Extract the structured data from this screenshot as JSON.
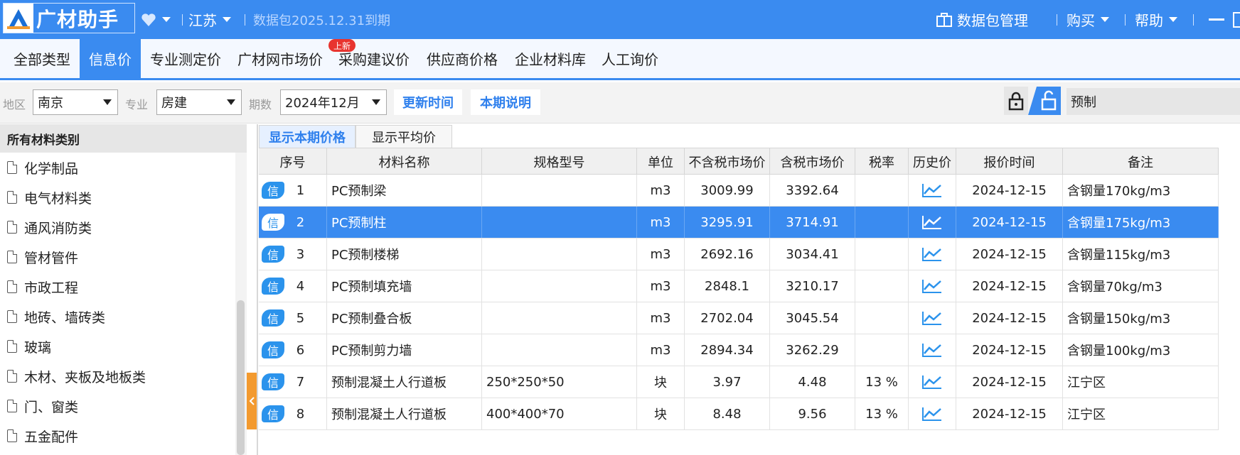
{
  "titlebar": {
    "logo_text": "广材助手",
    "region": "江苏",
    "package_expiry": "数据包2025.12.31到期",
    "package_manage": "数据包管理",
    "buy": "购买",
    "help": "帮助"
  },
  "nav": {
    "tabs": [
      "全部类型",
      "信息价",
      "专业测定价",
      "广材网市场价",
      "采购建议价",
      "供应商价格",
      "企业材料库",
      "人工询价"
    ],
    "active_index": 1,
    "new_badge": "上新"
  },
  "filters": {
    "region_label": "地区",
    "region_value": "南京",
    "major_label": "专业",
    "major_value": "房建",
    "period_label": "期数",
    "period_value": "2024年12月",
    "update_time_btn": "更新时间",
    "period_desc_btn": "本期说明",
    "search_value": "预制"
  },
  "sidebar": {
    "header": "所有材料类别",
    "items": [
      "化学制品",
      "电气材料类",
      "通风消防类",
      "管材管件",
      "市政工程",
      "地砖、墙砖类",
      "玻璃",
      "木材、夹板及地板类",
      "门、窗类",
      "五金配件"
    ]
  },
  "subtabs": {
    "current": "显示本期价格",
    "average": "显示平均价"
  },
  "table": {
    "columns": [
      "序号",
      "材料名称",
      "规格型号",
      "单位",
      "不含税市场价",
      "含税市场价",
      "税率",
      "历史价",
      "报价时间",
      "备注"
    ],
    "tag": "信",
    "selected_row": 1,
    "rows": [
      {
        "no": "1",
        "name": "PC预制梁",
        "spec": "",
        "unit": "m3",
        "price_ex": "3009.99",
        "price_in": "3392.64",
        "tax": "",
        "date": "2024-12-15",
        "note": "含钢量170kg/m3"
      },
      {
        "no": "2",
        "name": "PC预制柱",
        "spec": "",
        "unit": "m3",
        "price_ex": "3295.91",
        "price_in": "3714.91",
        "tax": "",
        "date": "2024-12-15",
        "note": "含钢量175kg/m3"
      },
      {
        "no": "3",
        "name": "PC预制楼梯",
        "spec": "",
        "unit": "m3",
        "price_ex": "2692.16",
        "price_in": "3034.41",
        "tax": "",
        "date": "2024-12-15",
        "note": "含钢量115kg/m3"
      },
      {
        "no": "4",
        "name": "PC预制填充墙",
        "spec": "",
        "unit": "m3",
        "price_ex": "2848.1",
        "price_in": "3210.17",
        "tax": "",
        "date": "2024-12-15",
        "note": "含钢量70kg/m3"
      },
      {
        "no": "5",
        "name": "PC预制叠合板",
        "spec": "",
        "unit": "m3",
        "price_ex": "2702.04",
        "price_in": "3045.54",
        "tax": "",
        "date": "2024-12-15",
        "note": "含钢量150kg/m3"
      },
      {
        "no": "6",
        "name": "PC预制剪力墙",
        "spec": "",
        "unit": "m3",
        "price_ex": "2894.34",
        "price_in": "3262.29",
        "tax": "",
        "date": "2024-12-15",
        "note": "含钢量100kg/m3"
      },
      {
        "no": "7",
        "name": "预制混凝土人行道板",
        "spec": "250*250*50",
        "unit": "块",
        "price_ex": "3.97",
        "price_in": "4.48",
        "tax": "13 %",
        "date": "2024-12-15",
        "note": "江宁区"
      },
      {
        "no": "8",
        "name": "预制混凝土人行道板",
        "spec": "400*400*70",
        "unit": "块",
        "price_ex": "8.48",
        "price_in": "9.56",
        "tax": "13 %",
        "date": "2024-12-15",
        "note": "江宁区"
      }
    ]
  },
  "colors": {
    "brand_blue": "#3a8bf0",
    "link_blue": "#2f80ed",
    "badge_red": "#e8342f",
    "handle_orange": "#f39a2f"
  }
}
